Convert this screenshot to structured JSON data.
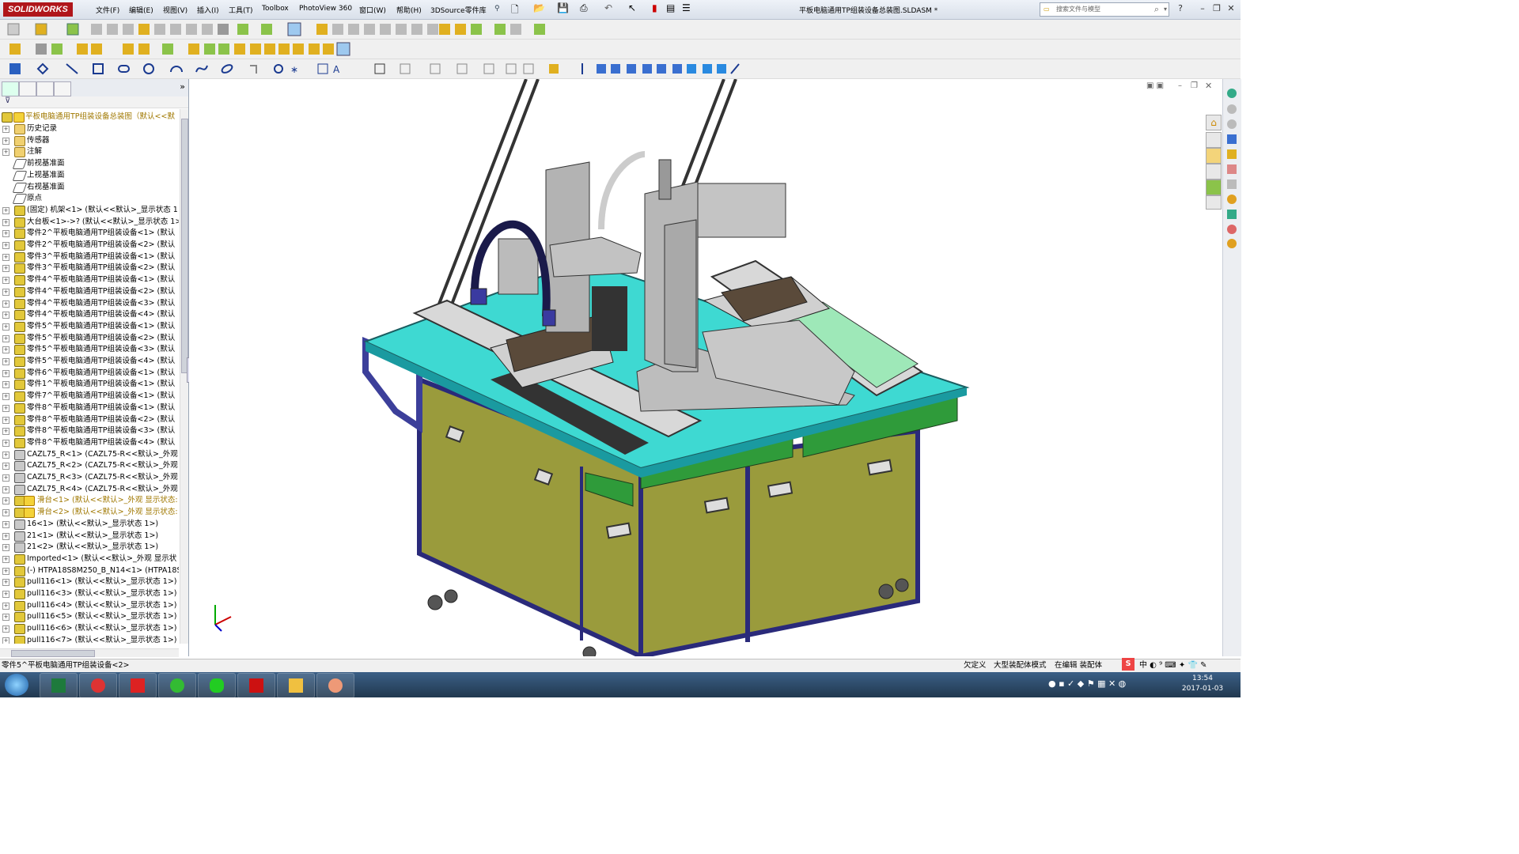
{
  "app": {
    "logo": "SOLIDWORKS",
    "menus": [
      "文件(F)",
      "编辑(E)",
      "视图(V)",
      "插入(I)",
      "工具(T)",
      "Toolbox",
      "PhotoView 360",
      "窗口(W)",
      "帮助(H)",
      "3DSource零件库"
    ],
    "document_title": "平板电脑通用TP组装设备总装图.SLDASM *",
    "search_placeholder": "搜索文件与模型",
    "help_label": "?"
  },
  "tree": {
    "root_label": "平板电脑通用TP组装设备总装图（默认<<默",
    "items": [
      {
        "label": "历史记录",
        "icon": "history-icon",
        "type": "folder"
      },
      {
        "label": "传感器",
        "icon": "sensor-icon",
        "type": "folder"
      },
      {
        "label": "注解",
        "icon": "annotation-icon",
        "type": "annotation"
      },
      {
        "label": "前视基准面",
        "icon": "plane-icon",
        "type": "plane"
      },
      {
        "label": "上视基准面",
        "icon": "plane-icon",
        "type": "plane"
      },
      {
        "label": "右视基准面",
        "icon": "plane-icon",
        "type": "plane"
      },
      {
        "label": "原点",
        "icon": "origin-icon",
        "type": "origin"
      },
      {
        "label": "(固定) 机架<1> (默认<<默认>_显示状态 1",
        "type": "asm"
      },
      {
        "label": "大台板<1>->? (默认<<默认>_显示状态 1>",
        "type": "asm"
      },
      {
        "label": "零件2^平板电脑通用TP组装设备<1> (默认",
        "type": "asm"
      },
      {
        "label": "零件2^平板电脑通用TP组装设备<2> (默认",
        "type": "asm"
      },
      {
        "label": "零件3^平板电脑通用TP组装设备<1> (默认",
        "type": "asm"
      },
      {
        "label": "零件3^平板电脑通用TP组装设备<2> (默认",
        "type": "asm"
      },
      {
        "label": "零件4^平板电脑通用TP组装设备<1> (默认",
        "type": "asm"
      },
      {
        "label": "零件4^平板电脑通用TP组装设备<2> (默认",
        "type": "asm"
      },
      {
        "label": "零件4^平板电脑通用TP组装设备<3> (默认",
        "type": "asm"
      },
      {
        "label": "零件4^平板电脑通用TP组装设备<4> (默认",
        "type": "asm"
      },
      {
        "label": "零件5^平板电脑通用TP组装设备<1> (默认",
        "type": "asm"
      },
      {
        "label": "零件5^平板电脑通用TP组装设备<2> (默认",
        "type": "asm"
      },
      {
        "label": "零件5^平板电脑通用TP组装设备<3> (默认",
        "type": "asm"
      },
      {
        "label": "零件5^平板电脑通用TP组装设备<4> (默认",
        "type": "asm"
      },
      {
        "label": "零件6^平板电脑通用TP组装设备<1> (默认",
        "type": "asm"
      },
      {
        "label": "零件1^平板电脑通用TP组装设备<1> (默认",
        "type": "asm"
      },
      {
        "label": "零件7^平板电脑通用TP组装设备<1> (默认",
        "type": "asm"
      },
      {
        "label": "零件8^平板电脑通用TP组装设备<1> (默认",
        "type": "asm"
      },
      {
        "label": "零件8^平板电脑通用TP组装设备<2> (默认",
        "type": "asm"
      },
      {
        "label": "零件8^平板电脑通用TP组装设备<3> (默认",
        "type": "asm"
      },
      {
        "label": "零件8^平板电脑通用TP组装设备<4> (默认",
        "type": "asm"
      },
      {
        "label": "CAZL75_R<1> (CAZL75-R<<默认>_外观 5",
        "type": "part"
      },
      {
        "label": "CAZL75_R<2> (CAZL75-R<<默认>_外观 5",
        "type": "part"
      },
      {
        "label": "CAZL75_R<3> (CAZL75-R<<默认>_外观 5",
        "type": "part"
      },
      {
        "label": "CAZL75_R<4> (CAZL75-R<<默认>_外观 5",
        "type": "part"
      },
      {
        "label": "滑台<1> (默认<<默认>_外观 显示状态:",
        "type": "warn"
      },
      {
        "label": "滑台<2> (默认<<默认>_外观 显示状态:",
        "type": "warn"
      },
      {
        "label": "16<1> (默认<<默认>_显示状态 1>)",
        "type": "part"
      },
      {
        "label": "21<1> (默认<<默认>_显示状态 1>)",
        "type": "part"
      },
      {
        "label": "21<2> (默认<<默认>_显示状态 1>)",
        "type": "part"
      },
      {
        "label": "Imported<1> (默认<<默认>_外观 显示状",
        "type": "asm"
      },
      {
        "label": "(-) HTPA18S8M250_B_N14<1> (HTPA18S",
        "type": "asm"
      },
      {
        "label": "pull116<1> (默认<<默认>_显示状态 1>)",
        "type": "asm"
      },
      {
        "label": "pull116<3> (默认<<默认>_显示状态 1>)",
        "type": "asm"
      },
      {
        "label": "pull116<4> (默认<<默认>_显示状态 1>)",
        "type": "asm"
      },
      {
        "label": "pull116<5> (默认<<默认>_显示状态 1>)",
        "type": "asm"
      },
      {
        "label": "pull116<6> (默认<<默认>_显示状态 1>)",
        "type": "asm"
      },
      {
        "label": "pull116<7> (默认<<默认>_显示状态 1>)",
        "type": "asm"
      }
    ]
  },
  "status": {
    "selection": "零件5^平板电脑通用TP组装设备<2>",
    "definition": "欠定义",
    "mode": "大型装配体模式",
    "editing": "在编辑 装配体"
  },
  "taskbar": {
    "time": "13:54",
    "date": "2017-01-03"
  },
  "colors": {
    "table_top": "#3ed9d2",
    "frame": "#3c3f9a",
    "panel": "#9b9b3a",
    "green_band": "#2f9b3a",
    "machine_gray": "#c8c8c8"
  }
}
